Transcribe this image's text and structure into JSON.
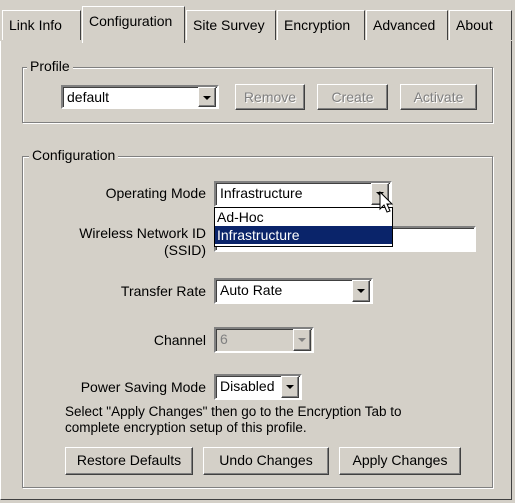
{
  "tabs": [
    {
      "label": "Link Info"
    },
    {
      "label": "Configuration"
    },
    {
      "label": "Site Survey"
    },
    {
      "label": "Encryption"
    },
    {
      "label": "Advanced"
    },
    {
      "label": "About"
    }
  ],
  "profile": {
    "group_label": "Profile",
    "selected": "default",
    "remove_label": "Remove",
    "create_label": "Create",
    "activate_label": "Activate"
  },
  "configuration": {
    "group_label": "Configuration",
    "operating_mode_label": "Operating Mode",
    "operating_mode_value": "Infrastructure",
    "operating_mode_options": [
      "Ad-Hoc",
      "Infrastructure"
    ],
    "ssid_label_line1": "Wireless Network ID",
    "ssid_label_line2": "(SSID)",
    "ssid_value": "",
    "transfer_rate_label": "Transfer Rate",
    "transfer_rate_value": "Auto Rate",
    "channel_label": "Channel",
    "channel_value": "6",
    "power_saving_label": "Power Saving Mode",
    "power_saving_value": "Disabled",
    "note_line1": "Select \"Apply Changes\" then go to the Encryption Tab to",
    "note_line2": "complete encryption setup of this profile.",
    "restore_label": "Restore Defaults",
    "undo_label": "Undo Changes",
    "apply_label": "Apply Changes"
  },
  "colors": {
    "face": "#d4d0c8",
    "highlight": "#0a246a"
  }
}
